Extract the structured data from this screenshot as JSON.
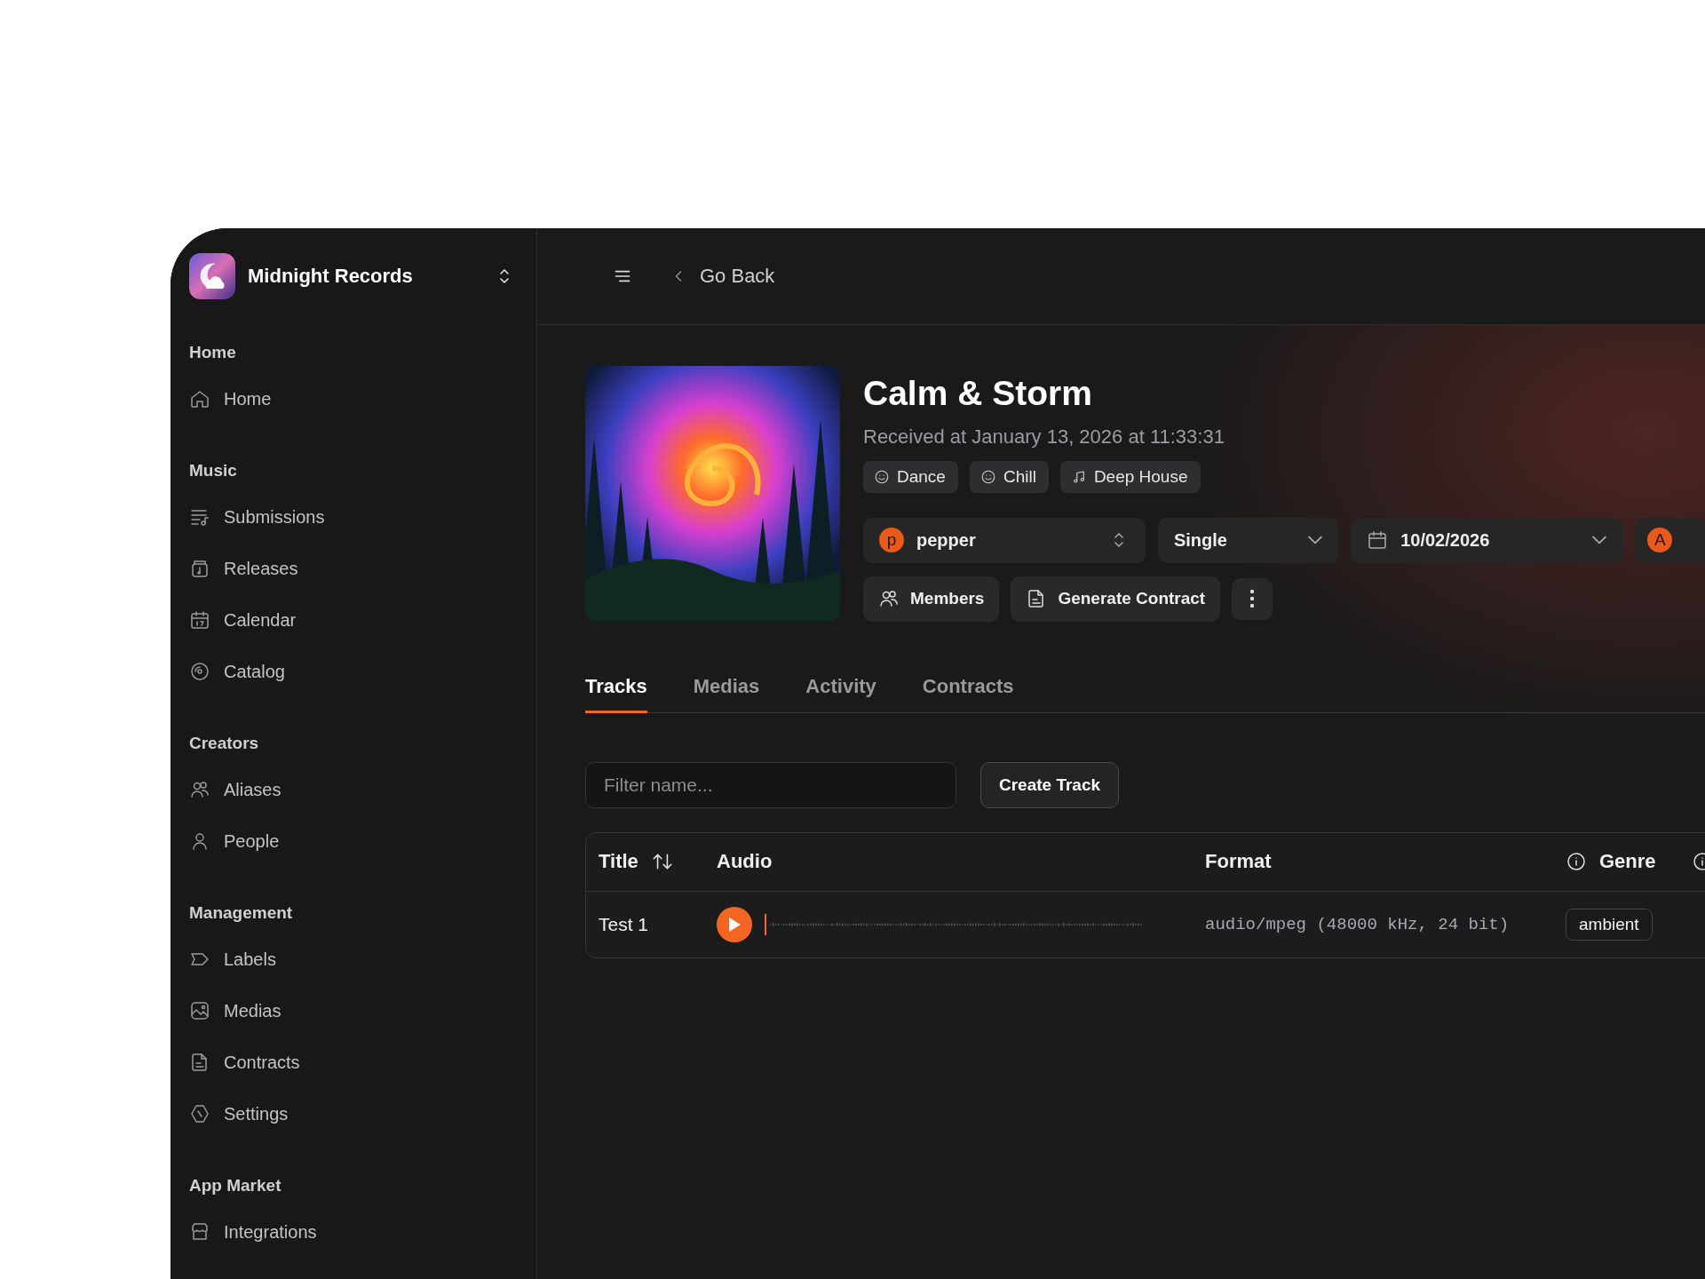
{
  "brand": {
    "name": "Midnight Records"
  },
  "sidebar": {
    "sections": [
      {
        "title": "Home",
        "items": [
          {
            "label": "Home"
          }
        ]
      },
      {
        "title": "Music",
        "items": [
          {
            "label": "Submissions"
          },
          {
            "label": "Releases"
          },
          {
            "label": "Calendar"
          },
          {
            "label": "Catalog"
          }
        ]
      },
      {
        "title": "Creators",
        "items": [
          {
            "label": "Aliases"
          },
          {
            "label": "People"
          }
        ]
      },
      {
        "title": "Management",
        "items": [
          {
            "label": "Labels"
          },
          {
            "label": "Medias"
          },
          {
            "label": "Contracts"
          },
          {
            "label": "Settings"
          }
        ]
      },
      {
        "title": "App Market",
        "items": [
          {
            "label": "Integrations"
          }
        ]
      }
    ]
  },
  "header": {
    "back_label": "Go Back"
  },
  "release": {
    "title": "Calm & Storm",
    "received": "Received at January 13, 2026 at 11:33:31",
    "tags": [
      {
        "label": "Dance",
        "kind": "mood"
      },
      {
        "label": "Chill",
        "kind": "mood"
      },
      {
        "label": "Deep House",
        "kind": "genre"
      }
    ],
    "owner": {
      "initial": "p",
      "name": "pepper"
    },
    "type": "Single",
    "date": "10/02/2026",
    "assignee_initial": "A",
    "actions": [
      {
        "label": "Members",
        "kind": "members"
      },
      {
        "label": "Generate Contract",
        "kind": "contract"
      }
    ]
  },
  "tabs": [
    {
      "label": "Tracks",
      "selected": true
    },
    {
      "label": "Medias",
      "selected": false
    },
    {
      "label": "Activity",
      "selected": false
    },
    {
      "label": "Contracts",
      "selected": false
    }
  ],
  "filter": {
    "placeholder": "Filter name..."
  },
  "create_button": "Create Track",
  "table": {
    "columns": [
      {
        "label": "Title",
        "kind": "sortable"
      },
      {
        "label": "Audio",
        "kind": "plain"
      },
      {
        "label": "Format",
        "kind": "plain"
      },
      {
        "label": "Genre",
        "kind": "info"
      }
    ],
    "rows": [
      {
        "title": "Test 1",
        "format": "audio/mpeg (48000 kHz, 24 bit)",
        "genre": "ambient"
      }
    ]
  }
}
